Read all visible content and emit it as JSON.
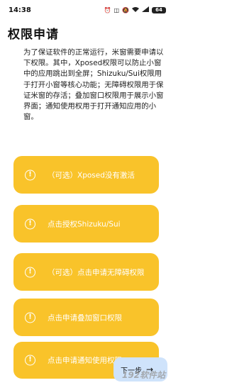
{
  "status_bar": {
    "time": "14:38",
    "icons": [
      "alarm-icon",
      "nfc-icon",
      "mute-icon",
      "wifi-icon",
      "signal-icon"
    ],
    "battery": "64"
  },
  "page": {
    "title": "权限申请",
    "intro": "为了保证软件的正常运行，米窗需要申请以下权限。其中，Xposed权限可以防止小窗中的应用跳出到全屏；Shizuku/Sui权限用于打开小窗等核心功能；无障碍权限用于保证米窗的存活；叠加窗口权限用于展示小窗界面；通知使用权用于打开通知应用的小窗。"
  },
  "cards": [
    {
      "icon": "alert-circle-icon",
      "label": "（可选）Xposed没有激活"
    },
    {
      "icon": "alert-circle-icon",
      "label": "点击授权Shizuku/Sui"
    },
    {
      "icon": "alert-circle-icon",
      "label": "（可选）点击申请无障碍权限"
    },
    {
      "icon": "alert-circle-icon",
      "label": "点击申请叠加窗口权限"
    },
    {
      "icon": "alert-circle-icon",
      "label": "点击申请通知使用权限"
    }
  ],
  "next_button": {
    "label": "下一步",
    "icon": "arrow-right-icon"
  },
  "watermark": "192软件站",
  "colors": {
    "card": "#f9c32a",
    "next_button": "#cfe3fb"
  }
}
